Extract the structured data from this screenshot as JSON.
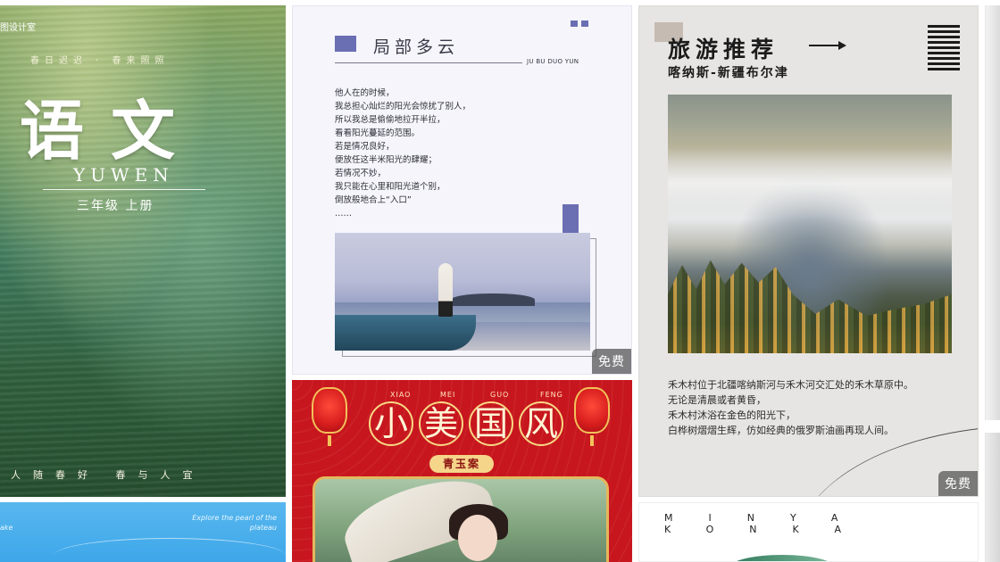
{
  "cards": {
    "yuwen": {
      "studio": "图设计室",
      "poem": "春日迟迟 · 春来照照",
      "title": "语文",
      "pinyin": "YUWEN",
      "grade": "三年级 上册",
      "footer": "人随春好 春与人宜"
    },
    "blue": {
      "left_text": "ake",
      "right_text": "Explore the pearl of the plateau"
    },
    "cloud": {
      "title": "局部多云",
      "pinyin": "JU BU DUO YUN",
      "poem_lines": [
        "他人在的时候，",
        "我总担心灿烂的阳光会惊扰了别人，",
        "所以我总是偷偷地拉开半拉，",
        "看看阳光蔓延的范围。",
        "若是情况良好，",
        "便放任这半米阳光的肆耀；",
        "若情况不妙，",
        "我只能在心里和阳光道个别，",
        "倒放般地合上“入口”",
        "……"
      ],
      "badge": "免费"
    },
    "guofeng": {
      "pinyin": [
        "XIAO",
        "MEI",
        "GUO",
        "FENG"
      ],
      "chars": [
        "小",
        "美",
        "国",
        "风"
      ],
      "subtitle": "青玉案"
    },
    "travel": {
      "title": "旅游推荐",
      "subtitle": "喀纳斯-新疆布尔津",
      "desc_lines": [
        "禾木村位于北疆喀纳斯河与禾木河交汇处的禾木草原中。",
        "无论是清晨或者黄昏，",
        "禾木村沐浴在金色的阳光下，",
        "白桦树熠熠生辉，仿如经典的俄罗斯油画再现人间。"
      ],
      "badge": "免费"
    },
    "minya": {
      "title": "MINYA KONKA"
    }
  },
  "colors": {
    "accent_purple": "#6a6eb2",
    "festive_red": "#c7161e",
    "gold": "#f5d58a",
    "badge_bg": "#505050"
  }
}
